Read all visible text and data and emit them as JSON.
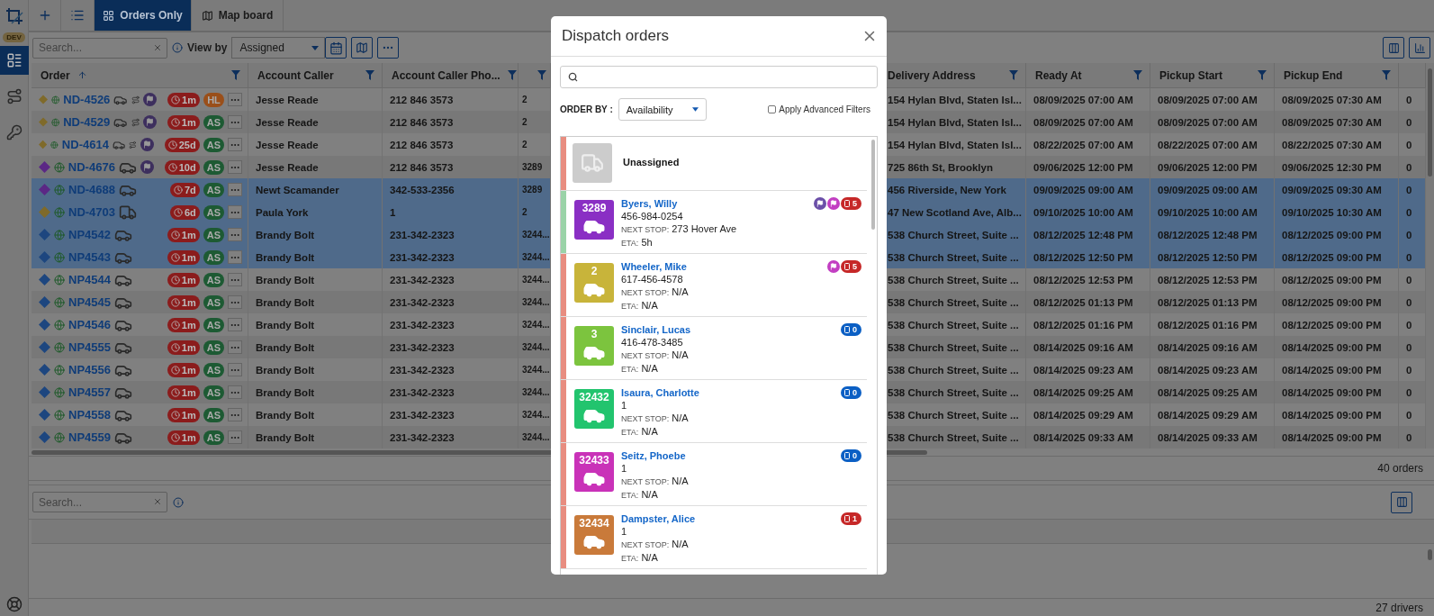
{
  "sidebar": {
    "env_badge": "DEV",
    "items": [
      {
        "kind": "orders",
        "selected": true
      },
      {
        "kind": "routes",
        "selected": false
      },
      {
        "kind": "keys",
        "selected": false
      }
    ]
  },
  "tabs": [
    {
      "kind": "grid",
      "label": "Orders Only",
      "selected": true
    },
    {
      "kind": "map",
      "label": "Map board",
      "selected": false
    }
  ],
  "toolbar": {
    "search_placeholder": "Search...",
    "view_by_label": "View by",
    "view_by_value": "Assigned"
  },
  "orders_table": {
    "columns": [
      {
        "label": "Order",
        "sorted": true
      },
      {
        "label": "Account Caller",
        "sorted": false
      },
      {
        "label": "Account Caller Pho...",
        "sorted": false
      },
      {
        "label": "Delivery Address",
        "sorted": false
      },
      {
        "label": "Ready At",
        "sorted": false
      },
      {
        "label": "Pickup Start",
        "sorted": false
      },
      {
        "label": "Pickup End",
        "sorted": false
      }
    ],
    "rows": [
      {
        "order": "ND-4526",
        "color": "#7f6a2a",
        "kind": "car",
        "route": true,
        "flagged": true,
        "age": "1m",
        "status": {
          "text": "HL",
          "color": "#9a4f1a"
        },
        "caller": "Jesse Reade",
        "phone": "212 846 3573",
        "column_4": "2",
        "delivery": "154 Hylan Blvd, Staten Isl...",
        "ready_at": "08/09/2025 07:00 AM",
        "pickup_start": "08/09/2025 07:00 AM",
        "pickup_end": "08/09/2025 07:30 AM",
        "column_10": "0",
        "selected": false
      },
      {
        "order": "ND-4529",
        "color": "#7f6a2a",
        "kind": "car",
        "route": true,
        "flagged": true,
        "age": "1m",
        "status": {
          "text": "AS",
          "color": "#1d5a33"
        },
        "caller": "Jesse Reade",
        "phone": "212 846 3573",
        "column_4": "2",
        "delivery": "154 Hylan Blvd, Staten Isl...",
        "ready_at": "08/09/2025 07:00 AM",
        "pickup_start": "08/09/2025 07:00 AM",
        "pickup_end": "08/09/2025 07:30 AM",
        "column_10": "0",
        "selected": false
      },
      {
        "order": "ND-4614",
        "color": "#7f6a2a",
        "kind": "car",
        "route": true,
        "flagged": true,
        "age": "25d",
        "status": {
          "text": "AS",
          "color": "#1d5a33"
        },
        "caller": "Jesse Reade",
        "phone": "212 846 3573",
        "column_4": "2",
        "delivery": "154 Hylan Blvd, Staten Isl...",
        "ready_at": "08/22/2025 07:00 AM",
        "pickup_start": "08/22/2025 07:00 AM",
        "pickup_end": "08/22/2025 07:30 AM",
        "column_10": "0",
        "selected": false
      },
      {
        "order": "ND-4676",
        "color": "#5b2785",
        "kind": "car",
        "route": false,
        "flagged": true,
        "age": "10d",
        "status": {
          "text": "AS",
          "color": "#1d5a33"
        },
        "caller": "Jesse Reade",
        "phone": "212 846 3573",
        "column_4": "3289",
        "delivery": "725 86th St, Brooklyn",
        "ready_at": "09/06/2025 12:00 PM",
        "pickup_start": "09/06/2025 12:00 PM",
        "pickup_end": "09/06/2025 12:30 PM",
        "column_10": "0",
        "selected": false
      },
      {
        "order": "ND-4688",
        "color": "#5b2785",
        "kind": "car",
        "route": false,
        "flagged": false,
        "age": "7d",
        "status": {
          "text": "AS",
          "color": "#1d5a33"
        },
        "caller": "Newt Scamander",
        "phone": "342-533-2356",
        "column_4": "3289",
        "delivery": "456 Riverside, New York",
        "ready_at": "09/09/2025 09:00 AM",
        "pickup_start": "09/09/2025 09:00 AM",
        "pickup_end": "09/09/2025 09:30 AM",
        "column_10": "0",
        "selected": true
      },
      {
        "order": "ND-4703",
        "color": "#7f6a2a",
        "kind": "van",
        "route": false,
        "flagged": false,
        "age": "6d",
        "status": {
          "text": "AS",
          "color": "#1d5a33"
        },
        "caller": "Paula York",
        "phone": "1",
        "column_4": "2",
        "delivery": "47 New Scotland Ave, Alb...",
        "ready_at": "09/10/2025 10:00 AM",
        "pickup_start": "09/10/2025 10:00 AM",
        "pickup_end": "09/10/2025 10:30 AM",
        "column_10": "0",
        "selected": true
      },
      {
        "order": "NP4542",
        "color": "#1d467f",
        "kind": "car",
        "route": false,
        "flagged": false,
        "age": "1m",
        "status": {
          "text": "AS",
          "color": "#1d5a33"
        },
        "caller": "Brandy Bolt",
        "phone": "231-342-2323",
        "column_4": "3244...",
        "delivery": "538 Church Street, Suite ...",
        "ready_at": "08/12/2025 12:48 PM",
        "pickup_start": "08/12/2025 12:48 PM",
        "pickup_end": "08/12/2025 09:00 PM",
        "column_10": "0",
        "selected": true
      },
      {
        "order": "NP4543",
        "color": "#1d467f",
        "kind": "car",
        "route": false,
        "flagged": false,
        "age": "1m",
        "status": {
          "text": "AS",
          "color": "#1d5a33"
        },
        "caller": "Brandy Bolt",
        "phone": "231-342-2323",
        "column_4": "3244...",
        "delivery": "538 Church Street, Suite ...",
        "ready_at": "08/12/2025 12:50 PM",
        "pickup_start": "08/12/2025 12:50 PM",
        "pickup_end": "08/12/2025 09:00 PM",
        "column_10": "0",
        "selected": true
      },
      {
        "order": "NP4544",
        "color": "#1d467f",
        "kind": "car",
        "route": false,
        "flagged": false,
        "age": "1m",
        "status": {
          "text": "AS",
          "color": "#1d5a33"
        },
        "caller": "Brandy Bolt",
        "phone": "231-342-2323",
        "column_4": "3244...",
        "delivery": "538 Church Street, Suite ...",
        "ready_at": "08/12/2025 12:53 PM",
        "pickup_start": "08/12/2025 12:53 PM",
        "pickup_end": "08/12/2025 09:00 PM",
        "column_10": "0",
        "selected": false
      },
      {
        "order": "NP4545",
        "color": "#1d467f",
        "kind": "car",
        "route": false,
        "flagged": false,
        "age": "1m",
        "status": {
          "text": "AS",
          "color": "#1d5a33"
        },
        "caller": "Brandy Bolt",
        "phone": "231-342-2323",
        "column_4": "3244...",
        "delivery": "538 Church Street, Suite ...",
        "ready_at": "08/12/2025 01:13 PM",
        "pickup_start": "08/12/2025 01:13 PM",
        "pickup_end": "08/12/2025 09:00 PM",
        "column_10": "0",
        "selected": false
      },
      {
        "order": "NP4546",
        "color": "#1d467f",
        "kind": "car",
        "route": false,
        "flagged": false,
        "age": "1m",
        "status": {
          "text": "AS",
          "color": "#1d5a33"
        },
        "caller": "Brandy Bolt",
        "phone": "231-342-2323",
        "column_4": "3244...",
        "delivery": "538 Church Street, Suite ...",
        "ready_at": "08/12/2025 01:16 PM",
        "pickup_start": "08/12/2025 01:16 PM",
        "pickup_end": "08/12/2025 09:00 PM",
        "column_10": "0",
        "selected": false
      },
      {
        "order": "NP4555",
        "color": "#1d467f",
        "kind": "car",
        "route": false,
        "flagged": false,
        "age": "1m",
        "status": {
          "text": "AS",
          "color": "#1d5a33"
        },
        "caller": "Brandy Bolt",
        "phone": "231-342-2323",
        "column_4": "3244...",
        "delivery": "538 Church Street, Suite ...",
        "ready_at": "08/14/2025 09:16 AM",
        "pickup_start": "08/14/2025 09:16 AM",
        "pickup_end": "08/14/2025 09:00 PM",
        "column_10": "0",
        "selected": false
      },
      {
        "order": "NP4556",
        "color": "#1d467f",
        "kind": "car",
        "route": false,
        "flagged": false,
        "age": "1m",
        "status": {
          "text": "AS",
          "color": "#1d5a33"
        },
        "caller": "Brandy Bolt",
        "phone": "231-342-2323",
        "column_4": "3244...",
        "delivery": "538 Church Street, Suite ...",
        "ready_at": "08/14/2025 09:23 AM",
        "pickup_start": "08/14/2025 09:23 AM",
        "pickup_end": "08/14/2025 09:00 PM",
        "column_10": "0",
        "selected": false
      },
      {
        "order": "NP4557",
        "color": "#1d467f",
        "kind": "car",
        "route": false,
        "flagged": false,
        "age": "1m",
        "status": {
          "text": "AS",
          "color": "#1d5a33"
        },
        "caller": "Brandy Bolt",
        "phone": "231-342-2323",
        "column_4": "3244...",
        "delivery": "538 Church Street, Suite ...",
        "ready_at": "08/14/2025 09:25 AM",
        "pickup_start": "08/14/2025 09:25 AM",
        "pickup_end": "08/14/2025 09:00 PM",
        "column_10": "0",
        "selected": false
      },
      {
        "order": "NP4558",
        "color": "#1d467f",
        "kind": "car",
        "route": false,
        "flagged": false,
        "age": "1m",
        "status": {
          "text": "AS",
          "color": "#1d5a33"
        },
        "caller": "Brandy Bolt",
        "phone": "231-342-2323",
        "column_4": "3244...",
        "delivery": "538 Church Street, Suite ...",
        "ready_at": "08/14/2025 09:29 AM",
        "pickup_start": "08/14/2025 09:29 AM",
        "pickup_end": "08/14/2025 09:00 PM",
        "column_10": "0",
        "selected": false
      },
      {
        "order": "NP4559",
        "color": "#1d467f",
        "kind": "car",
        "route": false,
        "flagged": false,
        "age": "1m",
        "status": {
          "text": "AS",
          "color": "#1d5a33"
        },
        "caller": "Brandy Bolt",
        "phone": "231-342-2323",
        "column_4": "3244...",
        "delivery": "538 Church Street, Suite ...",
        "ready_at": "08/14/2025 09:33 AM",
        "pickup_start": "08/14/2025 09:33 AM",
        "pickup_end": "08/14/2025 09:00 PM",
        "column_10": "0",
        "selected": false
      }
    ],
    "footer": "40 orders"
  },
  "drivers_panel": {
    "search_placeholder": "Search...",
    "footer": "27 drivers"
  },
  "dialog": {
    "title": "Dispatch orders",
    "order_by_label": "ORDER BY :",
    "order_by_value": "Availability",
    "advanced_filters": {
      "label": "Apply Advanced Filters",
      "checked": false
    },
    "entries": [
      {
        "kind": "unassigned",
        "label": "Unassigned",
        "available": false
      },
      {
        "kind": "driver",
        "number": "3289",
        "color": "#8a2fc4",
        "name": "Byers, Willy",
        "phone": "456-984-0254",
        "next_stop_label": "NEXT STOP:",
        "next_stop": "273 Hover Ave",
        "eta_label": "ETA:",
        "eta": "5h",
        "available": true,
        "flags": [
          {
            "color": "#6b4fa8"
          },
          {
            "color": "#c23ec2"
          }
        ],
        "count": {
          "text": "5",
          "color": "#c62828"
        }
      },
      {
        "kind": "driver",
        "number": "2",
        "color": "#c8b43a",
        "name": "Wheeler, Mike",
        "phone": "617-456-4578",
        "next_stop_label": "NEXT STOP:",
        "next_stop": "N/A",
        "eta_label": "ETA:",
        "eta": "N/A",
        "available": false,
        "flags": [
          {
            "color": "#c23ec2"
          }
        ],
        "count": {
          "text": "5",
          "color": "#c62828"
        }
      },
      {
        "kind": "driver",
        "number": "3",
        "color": "#7cc43e",
        "name": "Sinclair, Lucas",
        "phone": "416-478-3485",
        "next_stop_label": "NEXT STOP:",
        "next_stop": "N/A",
        "eta_label": "ETA:",
        "eta": "N/A",
        "available": false,
        "count": {
          "text": "0",
          "color": "#0b5fc4"
        }
      },
      {
        "kind": "driver",
        "number": "32432",
        "color": "#22c46e",
        "name": "Isaura, Charlotte",
        "phone": "1",
        "next_stop_label": "NEXT STOP:",
        "next_stop": "N/A",
        "eta_label": "ETA:",
        "eta": "N/A",
        "available": false,
        "count": {
          "text": "0",
          "color": "#0b5fc4"
        }
      },
      {
        "kind": "driver",
        "number": "32433",
        "color": "#c932b8",
        "name": "Seitz, Phoebe",
        "phone": "1",
        "next_stop_label": "NEXT STOP:",
        "next_stop": "N/A",
        "eta_label": "ETA:",
        "eta": "N/A",
        "available": false,
        "count": {
          "text": "0",
          "color": "#0b5fc4"
        }
      },
      {
        "kind": "driver",
        "number": "32434",
        "color": "#c97a3a",
        "name": "Dampster, Alice",
        "phone": "1",
        "next_stop_label": "NEXT STOP:",
        "next_stop": "N/A",
        "eta_label": "ETA:",
        "eta": "N/A",
        "available": false,
        "count": {
          "text": "1",
          "color": "#c62828"
        }
      }
    ]
  }
}
